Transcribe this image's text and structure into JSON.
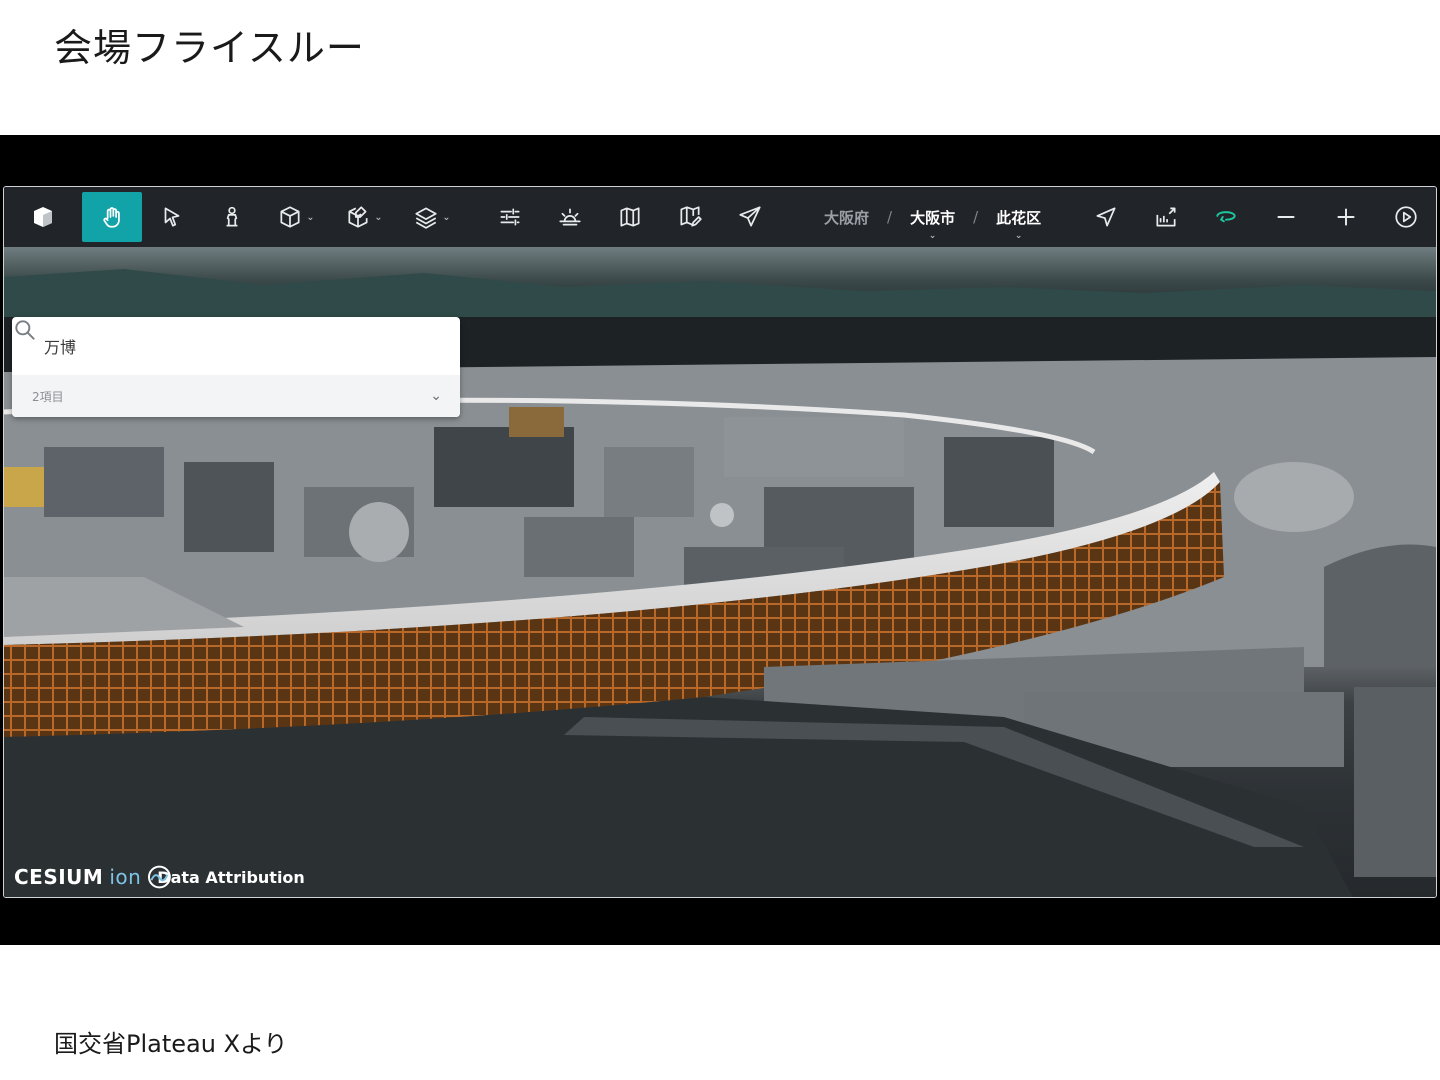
{
  "slide": {
    "title": "会場フライスルー",
    "caption": "国交省Plateau Xより"
  },
  "toolbar": {
    "tools": [
      {
        "name": "hand-tool",
        "icon": "hand-icon",
        "active": true
      },
      {
        "name": "select-tool",
        "icon": "cursor-icon"
      },
      {
        "name": "person-tool",
        "icon": "person-icon"
      },
      {
        "name": "cube-tool",
        "icon": "cube-icon",
        "dropdown": true
      },
      {
        "name": "cube-edit-tool",
        "icon": "cube-edit-icon",
        "dropdown": true
      },
      {
        "name": "layers-tool",
        "icon": "layers-icon",
        "dropdown": true
      },
      {
        "name": "sliders-tool",
        "icon": "sliders-icon"
      },
      {
        "name": "sun-tool",
        "icon": "sunrise-icon"
      },
      {
        "name": "map-tool",
        "icon": "map-icon"
      },
      {
        "name": "map-edit-tool",
        "icon": "map-edit-icon"
      },
      {
        "name": "send-tool",
        "icon": "send-icon"
      }
    ],
    "breadcrumb": [
      "大阪府",
      "大阪市",
      "此花区"
    ],
    "breadcrumb_sep": "/",
    "right_tools": [
      "locate-icon",
      "export-icon",
      "rotate-icon",
      "zoom-out-icon",
      "zoom-in-icon",
      "play-icon"
    ],
    "accent_color": "#12a3a8",
    "rotate_color": "#1ec6a0"
  },
  "search": {
    "value": "万博",
    "results_label": "2項目"
  },
  "attribution": {
    "brand": "CESIUM",
    "brand_suffix": "ion",
    "link": "Data Attribution"
  }
}
